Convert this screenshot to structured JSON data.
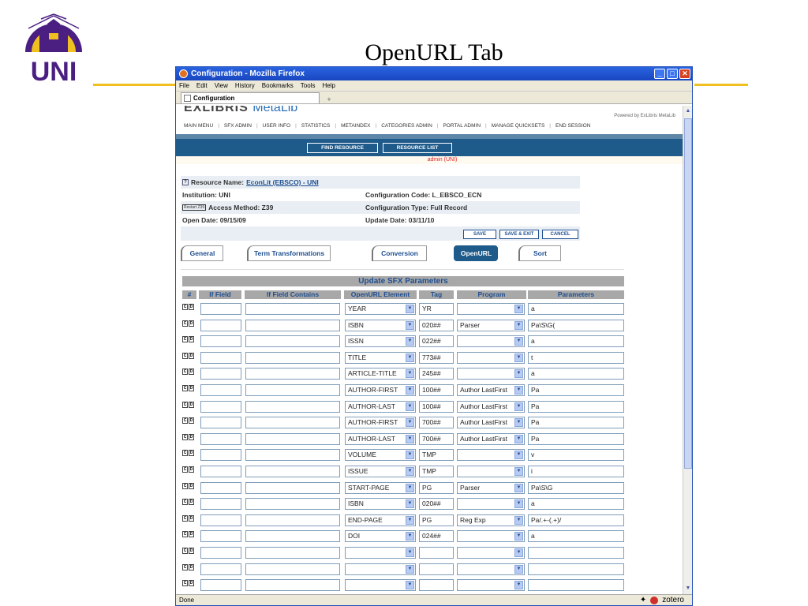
{
  "slide": {
    "title": "OpenURL Tab",
    "logo_text": "UNI",
    "accent": "#f0c020",
    "logo_color": "#4b1f82"
  },
  "browser": {
    "window_title": "Configuration - Mozilla Firefox",
    "menu": [
      "File",
      "Edit",
      "View",
      "History",
      "Bookmarks",
      "Tools",
      "Help"
    ],
    "tab_label": "Configuration",
    "new_tab": "+",
    "status": "Done",
    "zotero": "zotero"
  },
  "page": {
    "brand_main": "EXLIBRIS",
    "brand_sub": "MetaLib",
    "powered_by": "Powered by ExLibris MetaLib",
    "nav": [
      "MAIN MENU",
      "SFX ADMIN",
      "USER INFO",
      "STATISTICS",
      "METAINDEX",
      "CATEGORIES ADMIN",
      "PORTAL ADMIN",
      "MANAGE QUICKSETS",
      "END SESSION"
    ],
    "nav_buttons": [
      "FIND RESOURCE",
      "RESOURCE LIST"
    ],
    "admin_line": "admin (UNI)"
  },
  "resource": {
    "help": "?",
    "name_label": "Resource Name:",
    "name_value": "EconLit (EBSCO) - UNI",
    "institution": "Institution: UNI",
    "restart": "Restart Z39",
    "access": "Access Method: Z39",
    "open_date": "Open Date: 09/15/09",
    "config_code": "Configuration Code: L_EBSCO_ECN",
    "config_type": "Configuration Type: Full Record",
    "update_date": "Update Date: 03/11/10"
  },
  "actions": [
    "SAVE",
    "SAVE & EXIT",
    "CANCEL"
  ],
  "tabs": [
    "General",
    "Term Transformations",
    "Conversion",
    "OpenURL",
    "Sort"
  ],
  "params": {
    "title": "Update SFX Parameters",
    "columns": [
      "#",
      "If Field",
      "If Field Contains",
      "OpenURL Element",
      "Tag",
      "Program",
      "Parameters"
    ],
    "c_label": "C",
    "d_label": "D",
    "rows": [
      {
        "element": "YEAR",
        "tag": "YR",
        "program": "",
        "parameters": "a"
      },
      {
        "element": "ISBN",
        "tag": "020##",
        "program": "Parser",
        "parameters": "Pa\\S\\G("
      },
      {
        "element": "ISSN",
        "tag": "022##",
        "program": "",
        "parameters": "a"
      },
      {
        "element": "TITLE",
        "tag": "773##",
        "program": "",
        "parameters": "t"
      },
      {
        "element": "ARTICLE-TITLE",
        "tag": "245##",
        "program": "",
        "parameters": "a"
      },
      {
        "element": "AUTHOR-FIRST",
        "tag": "100##",
        "program": "Author LastFirst",
        "parameters": "Pa"
      },
      {
        "element": "AUTHOR-LAST",
        "tag": "100##",
        "program": "Author LastFirst",
        "parameters": "Pa"
      },
      {
        "element": "AUTHOR-FIRST",
        "tag": "700##",
        "program": "Author LastFirst",
        "parameters": "Pa"
      },
      {
        "element": "AUTHOR-LAST",
        "tag": "700##",
        "program": "Author LastFirst",
        "parameters": "Pa"
      },
      {
        "element": "VOLUME",
        "tag": "TMP",
        "program": "",
        "parameters": "v"
      },
      {
        "element": "ISSUE",
        "tag": "TMP",
        "program": "",
        "parameters": "i"
      },
      {
        "element": "START-PAGE",
        "tag": "PG",
        "program": "Parser",
        "parameters": "Pa\\S\\G"
      },
      {
        "element": "ISBN",
        "tag": "020##",
        "program": "",
        "parameters": "a"
      },
      {
        "element": "END-PAGE",
        "tag": "PG",
        "program": "Reg Exp",
        "parameters": "Pa/.+-(.+)/"
      },
      {
        "element": "DOI",
        "tag": "024##",
        "program": "",
        "parameters": "a"
      },
      {
        "element": "",
        "tag": "",
        "program": "",
        "parameters": ""
      },
      {
        "element": "",
        "tag": "",
        "program": "",
        "parameters": ""
      },
      {
        "element": "",
        "tag": "",
        "program": "",
        "parameters": ""
      }
    ]
  }
}
